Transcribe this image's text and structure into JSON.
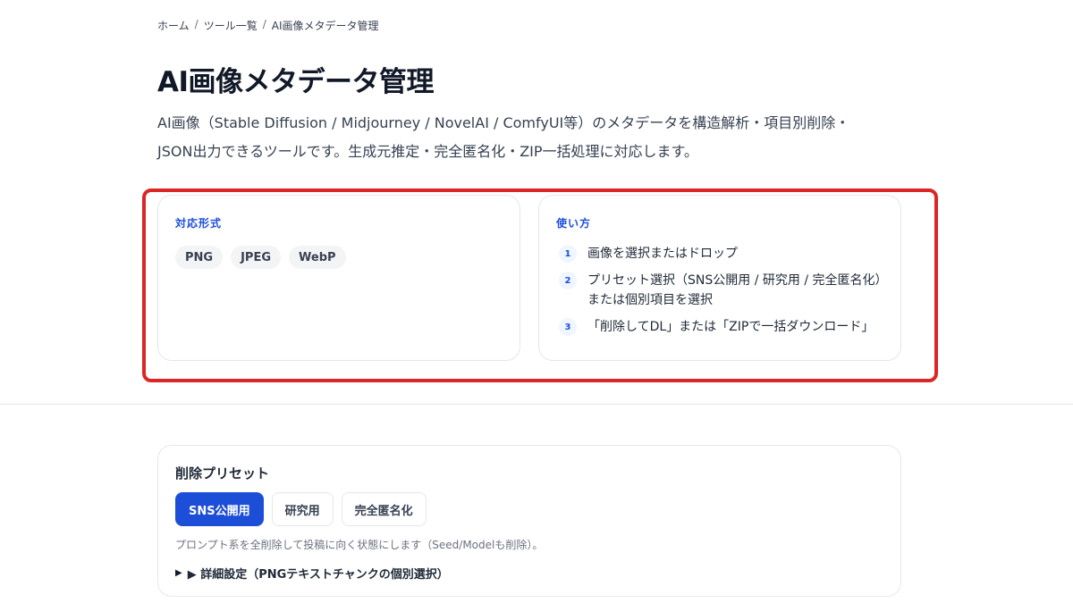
{
  "breadcrumb": [
    "ホーム",
    "ツール一覧",
    "AI画像メタデータ管理"
  ],
  "breadcrumb_separator": "/",
  "page_title": "AI画像メタデータ管理",
  "intro": {
    "line1": "AI画像（Stable Diffusion / Midjourney / NovelAI / ComfyUI等）のメタデータを構造解析・項目別削除・",
    "line2": "JSON出力できるツールです。生成元推定・完全匿名化・ZIP一括処理に対応します。"
  },
  "formats": {
    "label": "対応形式",
    "items": [
      "PNG",
      "JPEG",
      "WebP"
    ]
  },
  "usage": {
    "label": "使い方",
    "steps": [
      {
        "num": "1",
        "text": "画像を選択またはドロップ"
      },
      {
        "num": "2",
        "text": "プリセット選択（SNS公開用 / 研究用 / 完全匿名化）または個別項目を選択"
      },
      {
        "num": "3",
        "text": "「削除してDL」または「ZIPで一括ダウンロード」"
      }
    ]
  },
  "preset": {
    "title": "削除プリセット",
    "buttons": [
      "SNS公開用",
      "研究用",
      "完全匿名化"
    ],
    "active_index": 0,
    "description": "プロンプト系を全削除して投稿に向く状態にします（Seed/Modelも削除）。",
    "details_label": "▶ 詳細設定（PNGテキストチャンクの個別選択）"
  },
  "colors": {
    "accent": "#1d4ed8",
    "highlight_frame": "#dc2626"
  }
}
